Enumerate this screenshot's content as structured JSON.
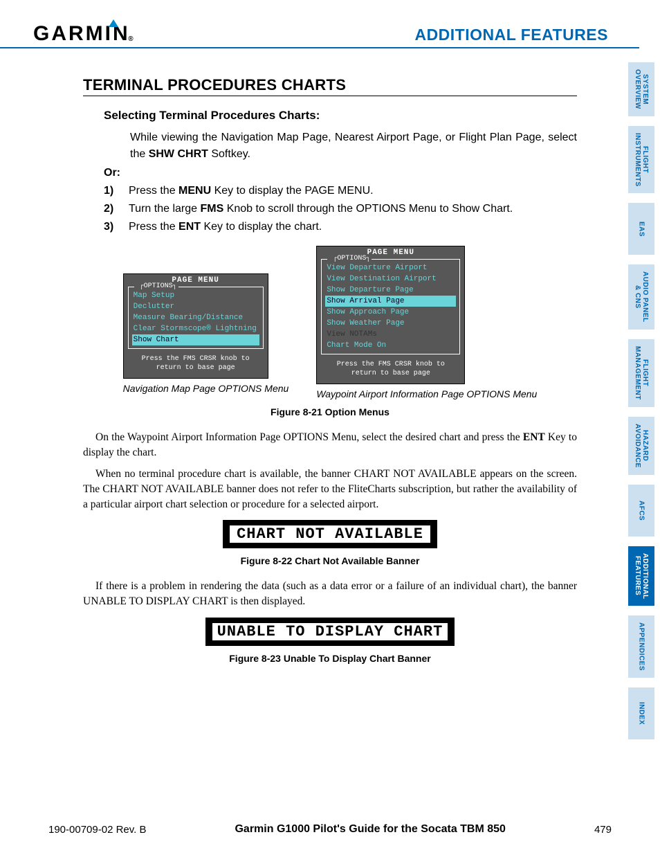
{
  "header": {
    "logo_text": "GARMIN",
    "title": "ADDITIONAL FEATURES"
  },
  "sidebar": {
    "tabs": [
      {
        "label": "SYSTEM\nOVERVIEW",
        "active": false
      },
      {
        "label": "FLIGHT\nINSTRUMENTS",
        "active": false
      },
      {
        "label": "EAS",
        "active": false
      },
      {
        "label": "AUDIO PANEL\n& CNS",
        "active": false
      },
      {
        "label": "FLIGHT\nMANAGEMENT",
        "active": false
      },
      {
        "label": "HAZARD\nAVOIDANCE",
        "active": false
      },
      {
        "label": "AFCS",
        "active": false
      },
      {
        "label": "ADDITIONAL\nFEATURES",
        "active": true
      },
      {
        "label": "APPENDICES",
        "active": false
      },
      {
        "label": "INDEX",
        "active": false
      }
    ]
  },
  "section": {
    "heading": "TERMINAL PROCEDURES CHARTS",
    "subheading": "Selecting Terminal Procedures Charts:",
    "intro_pre": "While viewing the Navigation Map Page, Nearest Airport Page, or Flight Plan Page, select the ",
    "intro_key": "SHW CHRT",
    "intro_post": " Softkey.",
    "or": "Or:",
    "steps": [
      {
        "num": "1)",
        "pre": "Press the ",
        "key": "MENU",
        "post": " Key to display the PAGE MENU."
      },
      {
        "num": "2)",
        "pre": "Turn the large ",
        "key": "FMS",
        "post": " Knob to scroll through the OPTIONS Menu to Show Chart."
      },
      {
        "num": "3)",
        "pre": "Press the ",
        "key": "ENT",
        "post": " Key to display the chart."
      }
    ]
  },
  "figure1": {
    "left": {
      "title": "PAGE MENU",
      "options_label": "OPTIONS",
      "items": [
        {
          "label": "Map Setup",
          "state": "normal"
        },
        {
          "label": "Declutter",
          "state": "normal"
        },
        {
          "label": "Measure Bearing/Distance",
          "state": "normal"
        },
        {
          "label": "Clear Stormscope® Lightning",
          "state": "normal"
        },
        {
          "label": "Show Chart",
          "state": "highlight"
        }
      ],
      "foot1": "Press the FMS CRSR knob to",
      "foot2": "return to base page",
      "caption": "Navigation Map Page OPTIONS Menu"
    },
    "right": {
      "title": "PAGE MENU",
      "options_label": "OPTIONS",
      "items": [
        {
          "label": "View Departure Airport",
          "state": "normal"
        },
        {
          "label": "View Destination Airport",
          "state": "normal"
        },
        {
          "label": "Show Departure Page",
          "state": "normal"
        },
        {
          "label": "Show Arrival Page",
          "state": "highlight"
        },
        {
          "label": "Show Approach Page",
          "state": "normal"
        },
        {
          "label": "Show Weather Page",
          "state": "normal"
        },
        {
          "label": "View NOTAMs",
          "state": "dim"
        },
        {
          "label": "Chart Mode On",
          "state": "normal"
        }
      ],
      "foot1": "Press the FMS CRSR knob to",
      "foot2": "return to base page",
      "caption": "Waypoint Airport Information Page OPTIONS Menu"
    },
    "caption": "Figure 8-21  Option Menus"
  },
  "body": {
    "p1_pre": "On the Waypoint Airport Information Page OPTIONS Menu, select the desired chart and press the ",
    "p1_key": "ENT",
    "p1_post": " Key to display the chart.",
    "p2": "When no terminal procedure chart is available, the banner CHART NOT AVAILABLE appears on the screen. The CHART NOT AVAILABLE banner does not refer to the FliteCharts subscription, but rather the availability of a particular airport chart selection or procedure for a selected airport.",
    "banner1": "CHART NOT AVAILABLE",
    "fig22": "Figure 8-22  Chart Not Available Banner",
    "p3": "If there is a problem in rendering the data (such as a data error or a failure of an individual chart), the banner UNABLE TO DISPLAY CHART is then displayed.",
    "banner2": "UNABLE TO DISPLAY CHART",
    "fig23": "Figure 8-23  Unable To Display Chart Banner"
  },
  "footer": {
    "left": "190-00709-02  Rev. B",
    "center": "Garmin G1000 Pilot's Guide for the Socata TBM 850",
    "right": "479"
  }
}
